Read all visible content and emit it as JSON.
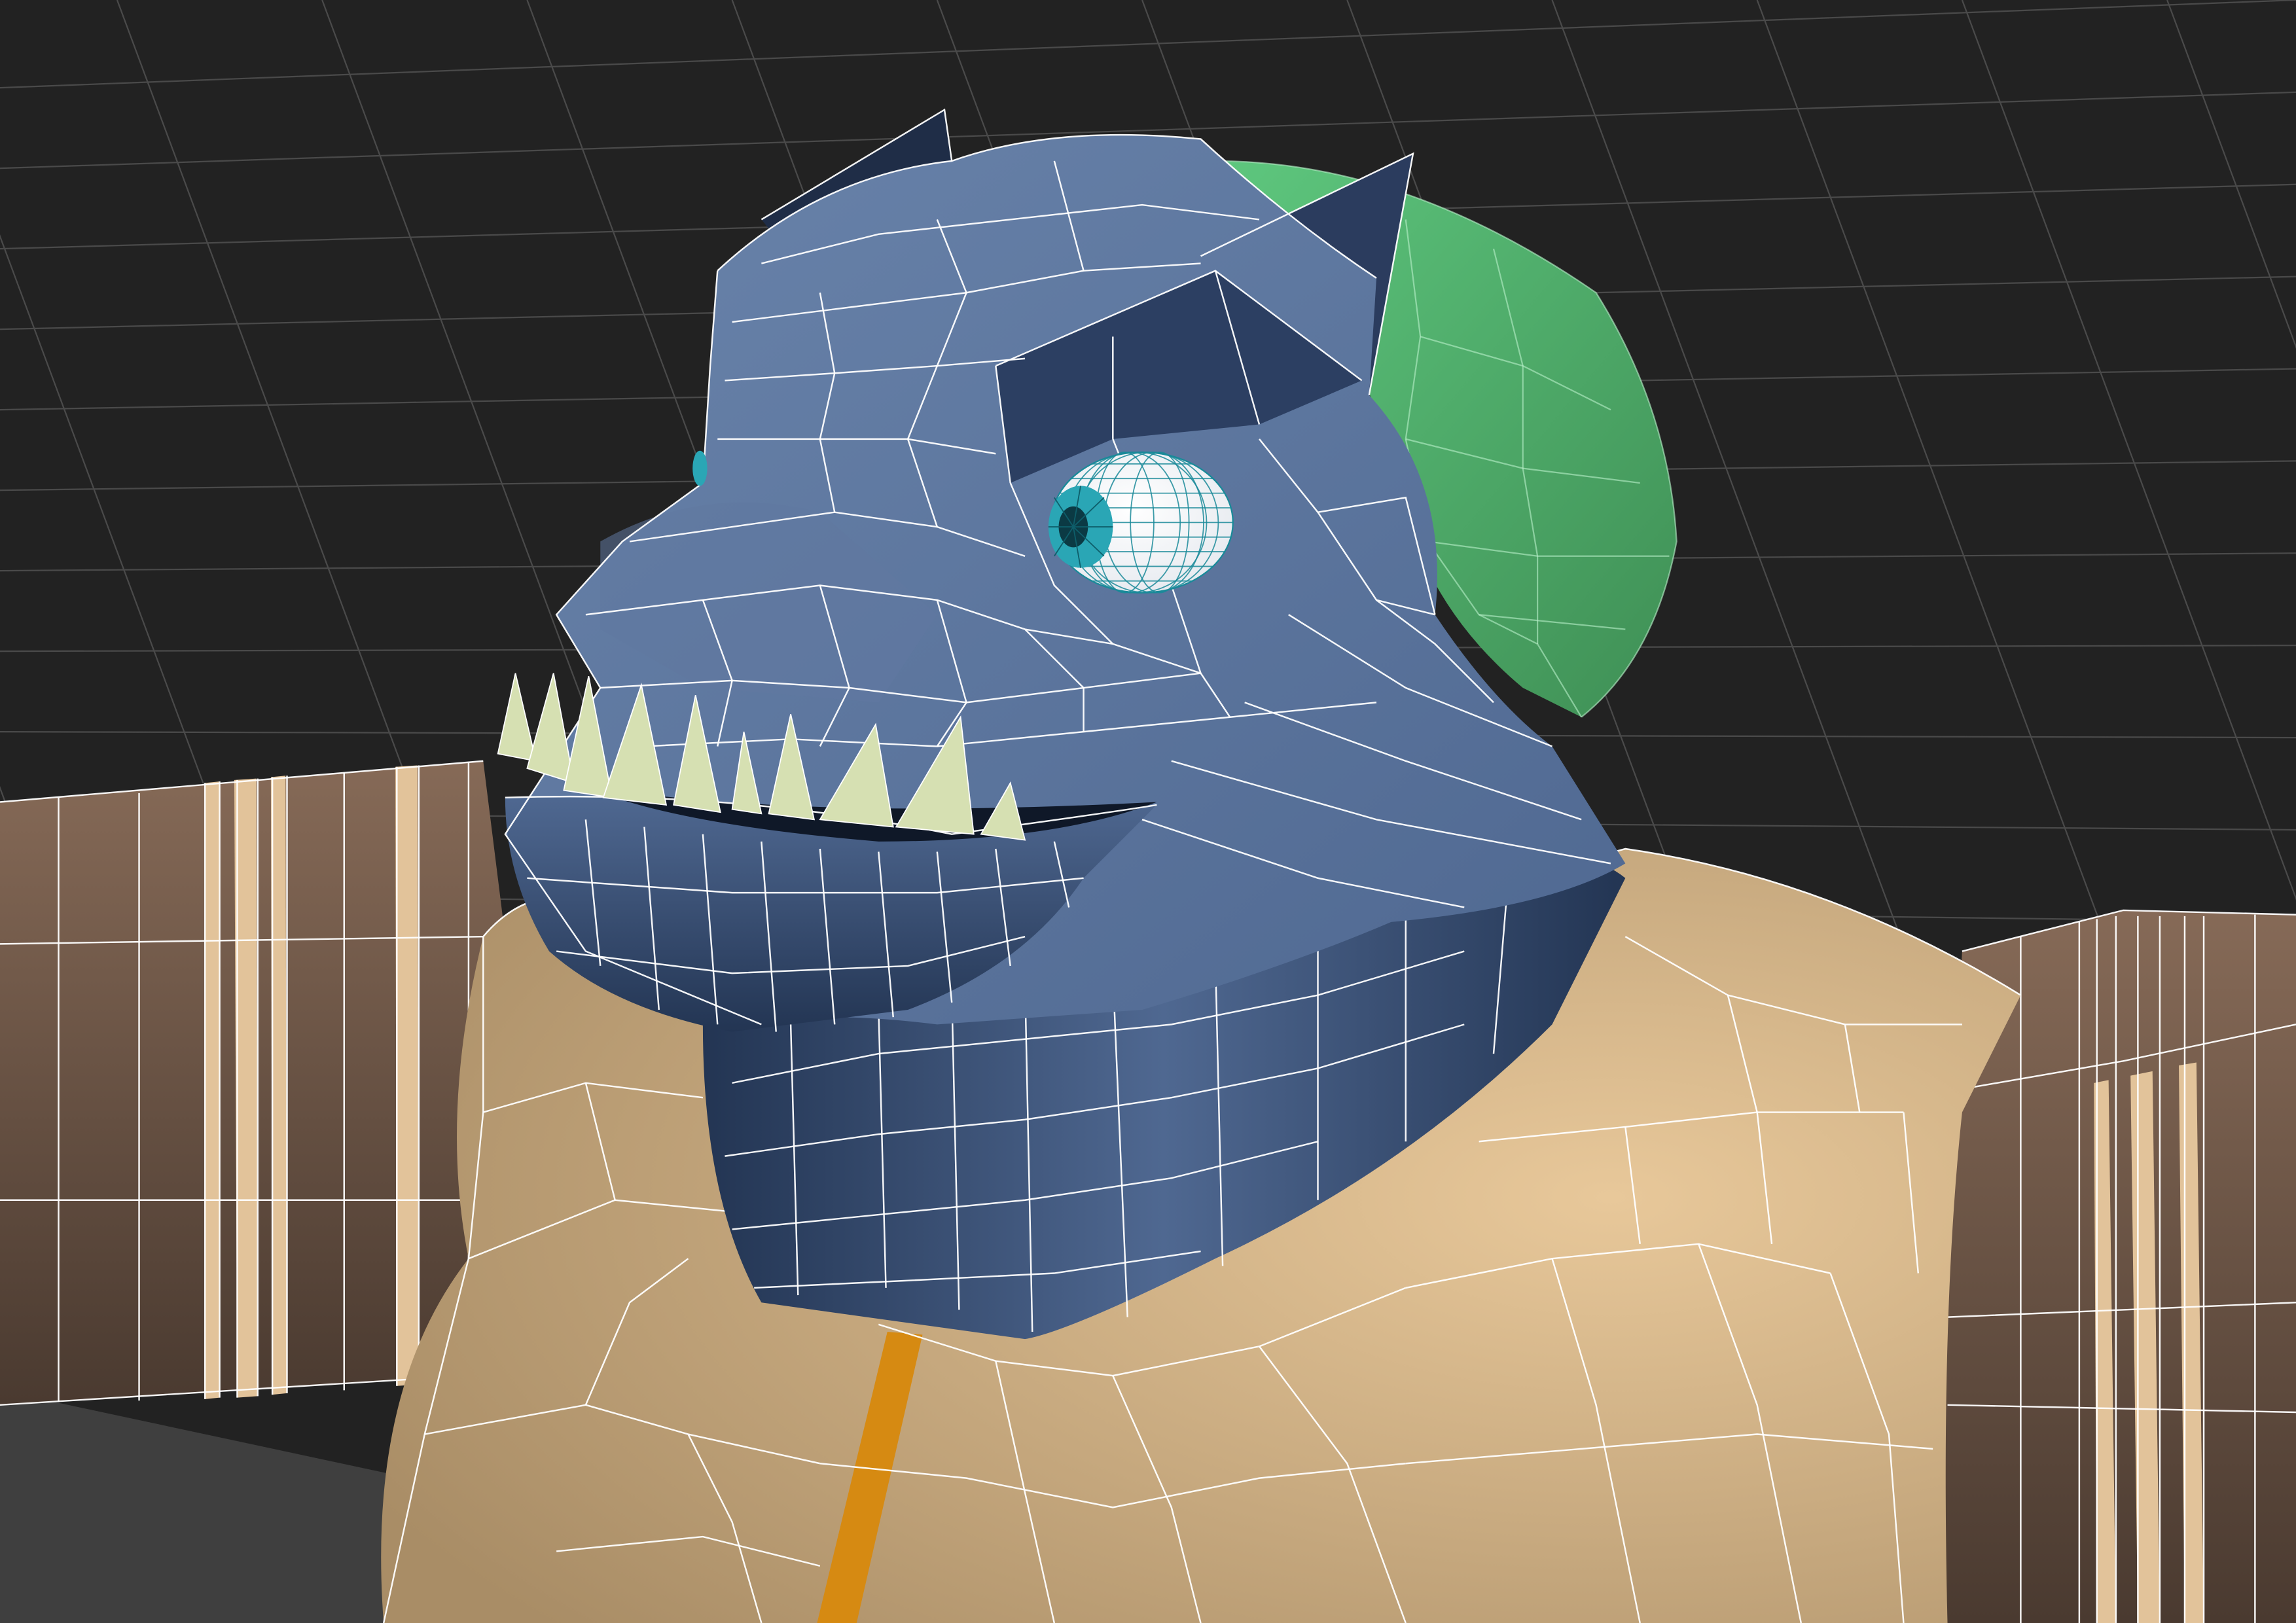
{
  "viewport": {
    "background": "#222222",
    "grid_color": "#4a4a4a",
    "wire_color": "#ffffff"
  },
  "model": {
    "colors": {
      "head_blue": "#4f6891",
      "head_blue_light": "#6a84ab",
      "head_blue_dark": "#233553",
      "body_tan": "#e8c89a",
      "body_tan_dark": "#a98d66",
      "arm_brown": "#866a57",
      "arm_brown_dark": "#4a3a30",
      "arm_stripe": "#e2c39a",
      "ear_green": "#5ec77e",
      "ear_green_dark": "#3f8f55",
      "teeth": "#d6e0b2",
      "eye_white": "#e4e8ee",
      "iris_teal": "#2aa6b5",
      "zipper_orange": "#d68a12",
      "floor_gray": "#3f3f3f"
    }
  }
}
